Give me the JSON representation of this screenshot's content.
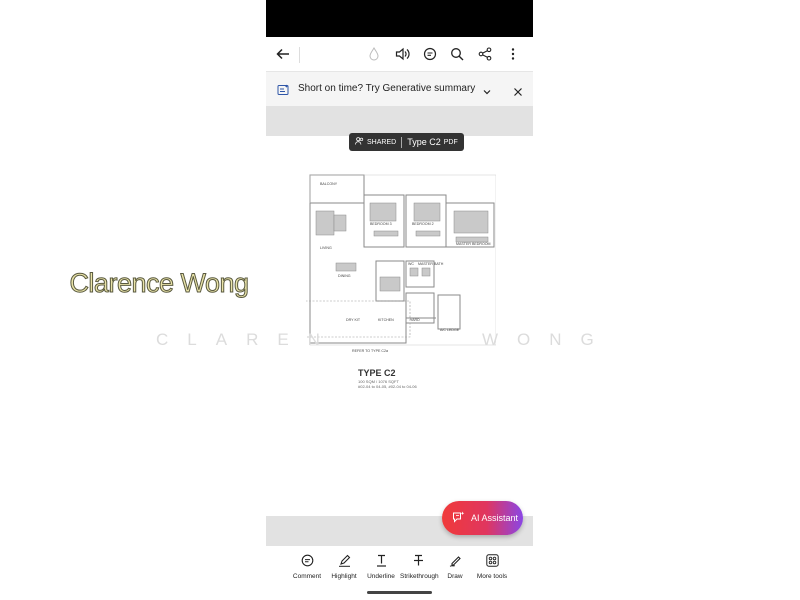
{
  "banner": {
    "text": "Short on time? Try Generative summary"
  },
  "doc_chip": {
    "shared": "SHARED",
    "title": "Type C2",
    "filetype": "PDF"
  },
  "floorplan": {
    "rooms": {
      "balcony": "BALCONY",
      "bedroom3": "BEDROOM 3",
      "bedroom2": "BEDROOM 2",
      "master": "MASTER BEDROOM",
      "living": "LIVING",
      "dining": "DINING",
      "wc": "WC",
      "master_bath": "MASTER BATH",
      "dry_kit": "DRY KIT",
      "kitchen": "KITCHEN",
      "yard": "YARD",
      "ac_ledge": "A/C LEDGE"
    },
    "refer": "REFER TO TYPE C2a",
    "type_title": "TYPE C2",
    "type_size": "100 SQM / 1076 SQFT",
    "type_units": "#02-04 to 04-05, #02-04 to 04-06"
  },
  "watermark": {
    "name": "Clarence Wong",
    "wide_left": "CLAREN",
    "wide_right": "WONG"
  },
  "ai_assistant": {
    "label": "AI Assistant"
  },
  "tools": [
    {
      "label": "Comment"
    },
    {
      "label": "Highlight"
    },
    {
      "label": "Underline"
    },
    {
      "label": "Strikethrough"
    },
    {
      "label": "Draw"
    },
    {
      "label": "More tools"
    }
  ]
}
